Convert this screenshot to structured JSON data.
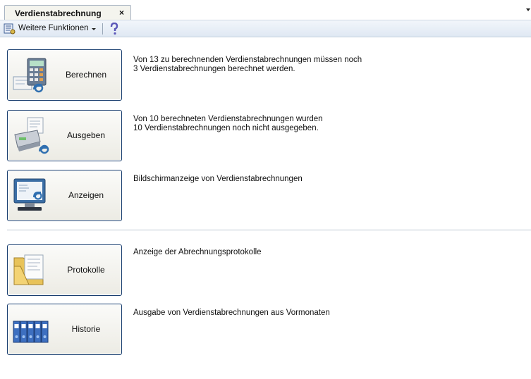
{
  "tab": {
    "title": "Verdienstabrechnung",
    "close_glyph": "×"
  },
  "toolbar": {
    "more_functions_label": "Weitere Funktionen",
    "help_icon": "help-icon"
  },
  "actions": [
    {
      "id": "berechnen",
      "label": "Berechnen",
      "description": "Von 13 zu berechnenden Verdienstabrechnungen müssen noch\n3 Verdienstabrechnungen berechnet werden.",
      "icon": "calculator-icon"
    },
    {
      "id": "ausgeben",
      "label": "Ausgeben",
      "description": "Von 10 berechneten Verdienstabrechnungen wurden\n10 Verdienstabrechnungen noch nicht ausgegeben.",
      "icon": "printer-icon"
    },
    {
      "id": "anzeigen",
      "label": "Anzeigen",
      "description": "Bildschirmanzeige von Verdienstabrechnungen",
      "icon": "monitor-icon"
    },
    {
      "id": "protokolle",
      "label": "Protokolle",
      "description": "Anzeige der Abrechnungsprotokolle",
      "icon": "folder-document-icon"
    },
    {
      "id": "historie",
      "label": "Historie",
      "description": "Ausgabe von Verdienstabrechnungen aus Vormonaten",
      "icon": "binders-icon"
    }
  ],
  "colors": {
    "button_border": "#1a3f70",
    "toolbar_bg": "#dfe8f3",
    "divider": "#bcc6d2"
  }
}
